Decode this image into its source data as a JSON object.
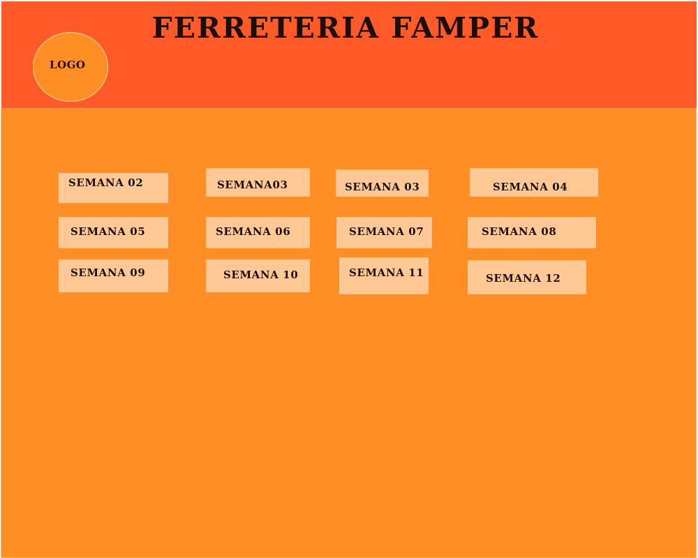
{
  "header": {
    "title": "FERRETERIA FAMPER",
    "logo_label": "LOGO"
  },
  "weeks": [
    {
      "label": "SEMANA 02"
    },
    {
      "label": "SEMANA03"
    },
    {
      "label": "SEMANA 03"
    },
    {
      "label": "SEMANA 04"
    },
    {
      "label": "SEMANA 05"
    },
    {
      "label": "SEMANA 06"
    },
    {
      "label": "SEMANA 07"
    },
    {
      "label": "SEMANA 08"
    },
    {
      "label": "SEMANA 09"
    },
    {
      "label": "SEMANA 10"
    },
    {
      "label": "SEMANA 11"
    },
    {
      "label": "SEMANA 12"
    }
  ],
  "colors": {
    "header_bg": "#ff5a28",
    "main_bg": "#ff8f24",
    "button_bg": "#ffc894",
    "text": "#1a0f0a"
  }
}
